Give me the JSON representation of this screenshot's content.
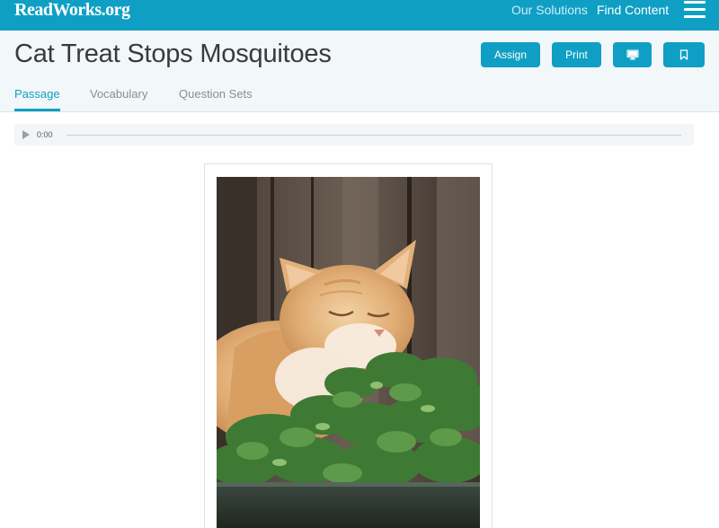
{
  "brand": {
    "logo_text": "ReadWorks.org"
  },
  "nav": {
    "solutions": "Our Solutions",
    "find_content": "Find Content"
  },
  "page": {
    "title": "Cat Treat Stops Mosquitoes"
  },
  "actions": {
    "assign": "Assign",
    "print": "Print"
  },
  "tabs": [
    {
      "label": "Passage",
      "active": true
    },
    {
      "label": "Vocabulary",
      "active": false
    },
    {
      "label": "Question Sets",
      "active": false
    }
  ],
  "audio": {
    "time": "0:00",
    "progress": 0
  },
  "colors": {
    "brand": "#0f9fc4",
    "header_bg": "#f2f7f9"
  },
  "icons": {
    "menu": "hamburger-menu-icon",
    "present": "monitor-icon",
    "bookmark": "bookmark-icon",
    "play": "play-icon"
  }
}
